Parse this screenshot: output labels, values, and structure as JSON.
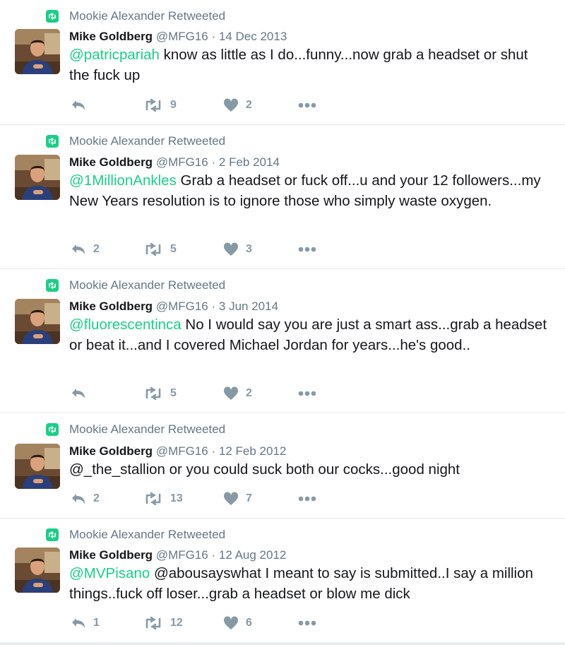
{
  "colors": {
    "accent": "#19cf86",
    "muted": "#8899a6",
    "text": "#14171a",
    "border": "#e6ecf0"
  },
  "tweets": [
    {
      "retweeted_by": "Mookie Alexander Retweeted",
      "name": "Mike Goldberg",
      "handle": "@MFG16",
      "sep": "·",
      "date": "14 Dec 2013",
      "mention": "@patricpariah",
      "text": " know as little as I do...funny...now grab a headset or shut the fuck up",
      "reply_count": "",
      "retweet_count": "9",
      "like_count": "2"
    },
    {
      "retweeted_by": "Mookie Alexander Retweeted",
      "name": "Mike Goldberg",
      "handle": "@MFG16",
      "sep": "·",
      "date": "2 Feb 2014",
      "mention": "@1MillionAnkles",
      "text": " Grab a headset or fuck off...u and your 12 followers...my New Years resolution is to ignore those who simply waste oxygen.",
      "reply_count": "2",
      "retweet_count": "5",
      "like_count": "3"
    },
    {
      "retweeted_by": "Mookie Alexander Retweeted",
      "name": "Mike Goldberg",
      "handle": "@MFG16",
      "sep": "·",
      "date": "3 Jun 2014",
      "mention": "@fluorescentinca",
      "text": " No I would say you are just a smart ass...grab a headset or beat it...and I covered Michael Jordan for years...he's good..",
      "reply_count": "",
      "retweet_count": "5",
      "like_count": "2"
    },
    {
      "retweeted_by": "Mookie Alexander Retweeted",
      "name": "Mike Goldberg",
      "handle": "@MFG16",
      "sep": "·",
      "date": "12 Feb 2012",
      "mention": "",
      "text": "@_the_stallion or you could suck both our cocks...good night",
      "reply_count": "2",
      "retweet_count": "13",
      "like_count": "7"
    },
    {
      "retweeted_by": "Mookie Alexander Retweeted",
      "name": "Mike Goldberg",
      "handle": "@MFG16",
      "sep": "·",
      "date": "12 Aug 2012",
      "mention": "@MVPisano",
      "text": " @abousayswhat I meant to say is submitted..I say a million things..fuck off loser...grab a headset or blow me dick",
      "reply_count": "1",
      "retweet_count": "12",
      "like_count": "6"
    }
  ]
}
